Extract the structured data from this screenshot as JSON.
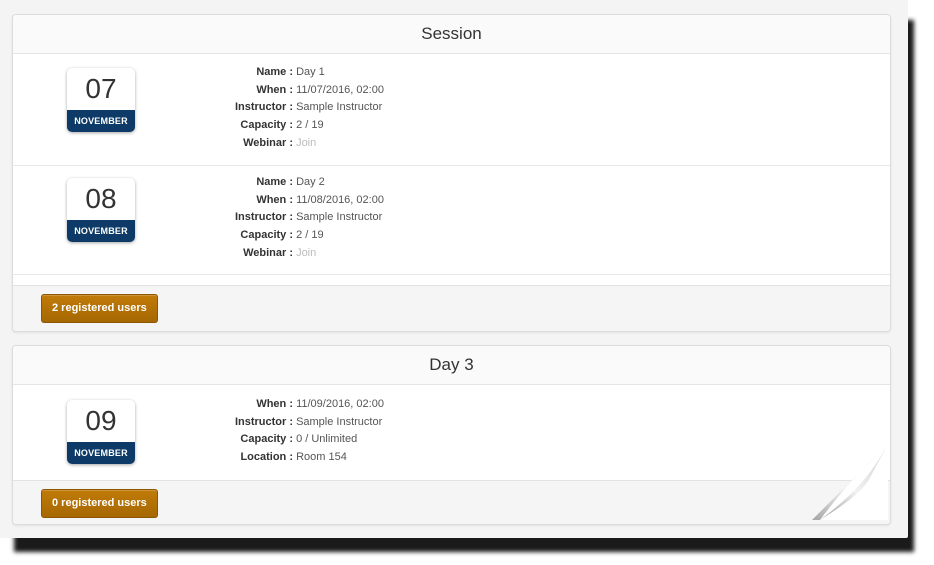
{
  "panels": [
    {
      "title": "Session",
      "sessions": [
        {
          "day": "07",
          "month": "NOVEMBER",
          "fields": [
            {
              "label": "Name :",
              "value": "Day 1"
            },
            {
              "label": "When :",
              "value": "11/07/2016, 02:00"
            },
            {
              "label": "Instructor :",
              "value": "Sample Instructor"
            },
            {
              "label": "Capacity :",
              "value": "2 / 19"
            },
            {
              "label": "Webinar :",
              "value": "Join"
            }
          ]
        },
        {
          "day": "08",
          "month": "NOVEMBER",
          "fields": [
            {
              "label": "Name :",
              "value": "Day 2"
            },
            {
              "label": "When :",
              "value": "11/08/2016, 02:00"
            },
            {
              "label": "Instructor :",
              "value": "Sample Instructor"
            },
            {
              "label": "Capacity :",
              "value": "2 / 19"
            },
            {
              "label": "Webinar :",
              "value": "Join"
            }
          ]
        }
      ],
      "registered_label": "2 registered users"
    },
    {
      "title": "Day 3",
      "sessions": [
        {
          "day": "09",
          "month": "NOVEMBER",
          "fields": [
            {
              "label": "When :",
              "value": "11/09/2016, 02:00"
            },
            {
              "label": "Instructor :",
              "value": "Sample Instructor"
            },
            {
              "label": "Capacity :",
              "value": "0 / Unlimited"
            },
            {
              "label": "Location :",
              "value": "Room 154"
            }
          ]
        }
      ],
      "registered_label": "0 registered users"
    }
  ],
  "colors": {
    "calendar_month_bg": "#0d3a66",
    "registered_button_bg": "#b37106",
    "link_muted": "#bbbbbb"
  }
}
